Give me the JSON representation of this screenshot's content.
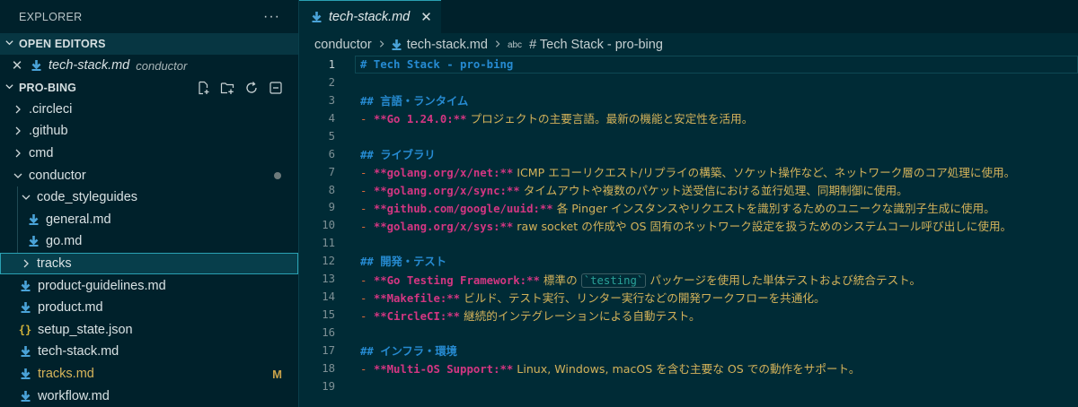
{
  "sidebar": {
    "title": "EXPLORER",
    "more": "···",
    "open_editors": {
      "label": "OPEN EDITORS",
      "items": [
        {
          "name": "tech-stack.md",
          "description": "conductor"
        }
      ]
    },
    "project": {
      "label": "PRO-BING",
      "actions": [
        "new-file-icon",
        "new-folder-icon",
        "refresh-icon",
        "collapse-all-icon"
      ]
    },
    "tree": [
      {
        "label": ".circleci"
      },
      {
        "label": ".github"
      },
      {
        "label": "cmd"
      },
      {
        "label": "conductor"
      },
      {
        "label": "code_styleguides"
      },
      {
        "label": "general.md"
      },
      {
        "label": "go.md"
      },
      {
        "label": "tracks"
      },
      {
        "label": "product-guidelines.md"
      },
      {
        "label": "product.md"
      },
      {
        "label": "setup_state.json"
      },
      {
        "label": "tech-stack.md"
      },
      {
        "label": "tracks.md",
        "git_status": "M"
      },
      {
        "label": "workflow.md"
      }
    ]
  },
  "editor": {
    "tab": {
      "label": "tech-stack.md",
      "close": "✕"
    },
    "breadcrumb": {
      "folder": "conductor",
      "file": "tech-stack.md",
      "abc": "abc",
      "symbol": "# Tech Stack - pro-bing"
    },
    "lines": [
      {
        "n": "1",
        "h": "# Tech Stack - pro-bing"
      },
      {
        "n": "2"
      },
      {
        "n": "3",
        "h": "## 言語・ランタイム"
      },
      {
        "n": "4",
        "d": "- ",
        "b": "**Go 1.24.0:**",
        "t": " プロジェクトの主要言語。最新の機能と安定性を活用。"
      },
      {
        "n": "5"
      },
      {
        "n": "6",
        "h": "## ライブラリ"
      },
      {
        "n": "7",
        "d": "- ",
        "b": "**golang.org/x/net:**",
        "t": " ICMP エコーリクエスト/リプライの構築、ソケット操作など、ネットワーク層のコア処理に使用。"
      },
      {
        "n": "8",
        "d": "- ",
        "b": "**golang.org/x/sync:**",
        "t": " タイムアウトや複数のパケット送受信における並行処理、同期制御に使用。"
      },
      {
        "n": "9",
        "d": "- ",
        "b": "**github.com/google/uuid:**",
        "t": " 各 Pinger インスタンスやリクエストを識別するためのユニークな識別子生成に使用。"
      },
      {
        "n": "10",
        "d": "- ",
        "b": "**golang.org/x/sys:**",
        "t": " raw socket の作成や OS 固有のネットワーク設定を扱うためのシステムコール呼び出しに使用。"
      },
      {
        "n": "11"
      },
      {
        "n": "12",
        "h": "## 開発・テスト"
      },
      {
        "n": "13",
        "d": "- ",
        "b": "**Go Testing Framework:**",
        "t": " 標準の ",
        "code": "`testing`",
        "t2": " パッケージを使用した単体テストおよび統合テスト。"
      },
      {
        "n": "14",
        "d": "- ",
        "b": "**Makefile:**",
        "t": " ビルド、テスト実行、リンター実行などの開発ワークフローを共通化。"
      },
      {
        "n": "15",
        "d": "- ",
        "b": "**CircleCI:**",
        "t": " 継続的インテグレーションによる自動テスト。"
      },
      {
        "n": "16"
      },
      {
        "n": "17",
        "h": "## インフラ・環境"
      },
      {
        "n": "18",
        "d": "- ",
        "b": "**Multi-OS Support:**",
        "t": " Linux, Windows, macOS を含む主要な OS での動作をサポート。"
      },
      {
        "n": "19"
      }
    ]
  },
  "colors": {
    "background": "#002b36",
    "heading": "#268bd2",
    "bold": "#d33682",
    "text": "#d3b25a",
    "accent": "#2aa1b3"
  }
}
